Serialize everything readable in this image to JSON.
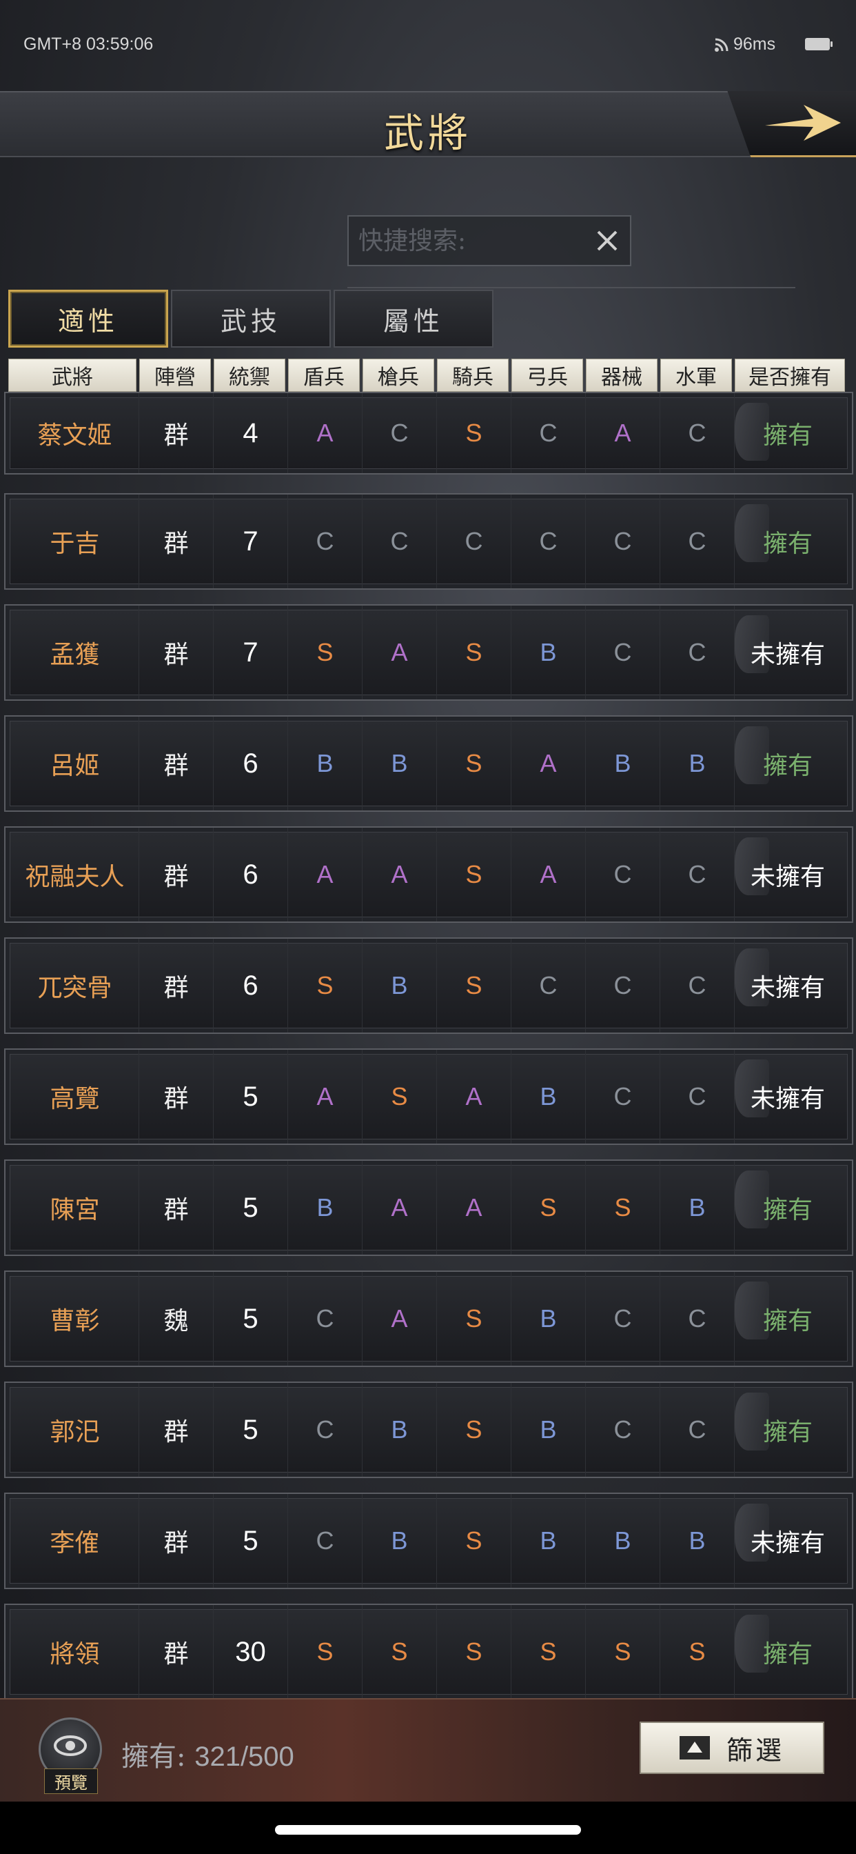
{
  "status_bar": {
    "time": "GMT+8 03:59:06",
    "ping": "96ms"
  },
  "header": {
    "title": "武將"
  },
  "search": {
    "placeholder": "快捷搜索:"
  },
  "tabs": [
    {
      "label": "適性",
      "active": true
    },
    {
      "label": "武技",
      "active": false
    },
    {
      "label": "屬性",
      "active": false
    }
  ],
  "columns": [
    "武將",
    "陣營",
    "統禦",
    "盾兵",
    "槍兵",
    "騎兵",
    "弓兵",
    "器械",
    "水軍",
    "是否擁有"
  ],
  "rows": [
    {
      "name": "蔡文姬",
      "camp": "群",
      "leadership": "4",
      "grades": [
        "A",
        "C",
        "S",
        "C",
        "A",
        "C"
      ],
      "owned": "擁有"
    },
    {
      "name": "于吉",
      "camp": "群",
      "leadership": "7",
      "grades": [
        "C",
        "C",
        "C",
        "C",
        "C",
        "C"
      ],
      "owned": "擁有"
    },
    {
      "name": "孟獲",
      "camp": "群",
      "leadership": "7",
      "grades": [
        "S",
        "A",
        "S",
        "B",
        "C",
        "C"
      ],
      "owned": "未擁有"
    },
    {
      "name": "呂姬",
      "camp": "群",
      "leadership": "6",
      "grades": [
        "B",
        "B",
        "S",
        "A",
        "B",
        "B"
      ],
      "owned": "擁有"
    },
    {
      "name": "祝融夫人",
      "camp": "群",
      "leadership": "6",
      "grades": [
        "A",
        "A",
        "S",
        "A",
        "C",
        "C"
      ],
      "owned": "未擁有"
    },
    {
      "name": "兀突骨",
      "camp": "群",
      "leadership": "6",
      "grades": [
        "S",
        "B",
        "S",
        "C",
        "C",
        "C"
      ],
      "owned": "未擁有"
    },
    {
      "name": "高覽",
      "camp": "群",
      "leadership": "5",
      "grades": [
        "A",
        "S",
        "A",
        "B",
        "C",
        "C"
      ],
      "owned": "未擁有"
    },
    {
      "name": "陳宮",
      "camp": "群",
      "leadership": "5",
      "grades": [
        "B",
        "A",
        "A",
        "S",
        "S",
        "B"
      ],
      "owned": "擁有"
    },
    {
      "name": "曹彰",
      "camp": "魏",
      "leadership": "5",
      "grades": [
        "C",
        "A",
        "S",
        "B",
        "C",
        "C"
      ],
      "owned": "擁有"
    },
    {
      "name": "郭汜",
      "camp": "群",
      "leadership": "5",
      "grades": [
        "C",
        "B",
        "S",
        "B",
        "C",
        "C"
      ],
      "owned": "擁有"
    },
    {
      "name": "李傕",
      "camp": "群",
      "leadership": "5",
      "grades": [
        "C",
        "B",
        "S",
        "B",
        "B",
        "B"
      ],
      "owned": "未擁有"
    },
    {
      "name": "將領",
      "camp": "群",
      "leadership": "30",
      "grades": [
        "S",
        "S",
        "S",
        "S",
        "S",
        "S"
      ],
      "owned": "擁有"
    }
  ],
  "owned_values": {
    "yes": "擁有",
    "no": "未擁有"
  },
  "grade_colors": {
    "S": "#e88b45",
    "A": "#b071c9",
    "B": "#7d97d6",
    "C": "#8b9199"
  },
  "footer": {
    "preview_label": "預覽",
    "owned_label": "擁有:",
    "owned_count": "321/500",
    "filter_label": "篩選"
  }
}
